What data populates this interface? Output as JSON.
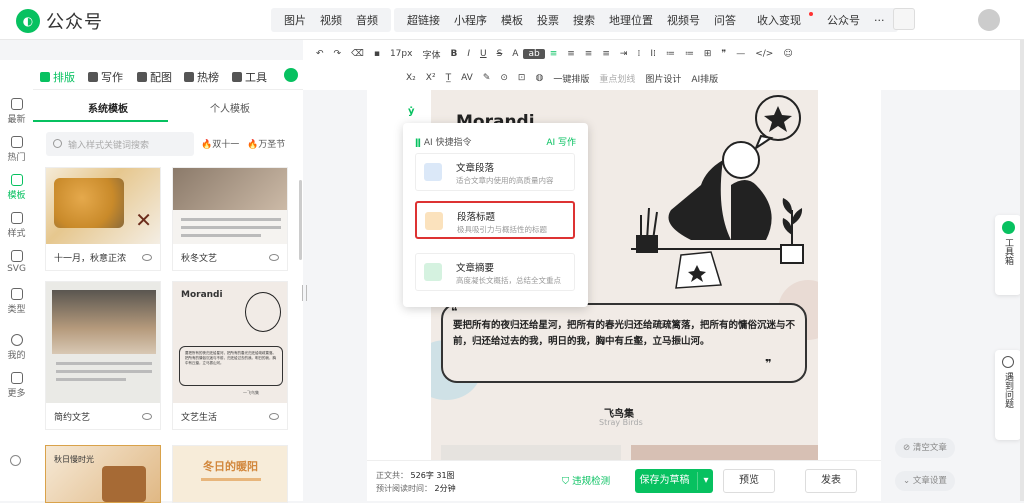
{
  "app": {
    "title": "公众号"
  },
  "top_menu": {
    "media": [
      "图片",
      "视频",
      "音频"
    ],
    "insert": [
      "超链接",
      "小程序",
      "模板",
      "投票",
      "搜索",
      "地理位置",
      "视频号",
      "问答",
      "收入变现",
      "公众号",
      "···"
    ]
  },
  "sidebar_tabs": [
    "排版",
    "写作",
    "配图",
    "热榜",
    "工具"
  ],
  "left_rail": [
    "最新",
    "热门",
    "模板",
    "样式",
    "SVG",
    "类型",
    "我的",
    "更多"
  ],
  "panel": {
    "subtabs": [
      "系统模板",
      "个人模板"
    ],
    "search_placeholder": "输入样式关键词搜索",
    "hot_chips": [
      "双十一",
      "万圣节"
    ],
    "templates": [
      {
        "name": "十一月，秋意正浓"
      },
      {
        "name": "秋冬文艺"
      },
      {
        "name": "简约文艺"
      },
      {
        "name": "文艺生活"
      },
      {
        "name": "秋日慢时光"
      },
      {
        "name": "冬日的暖阳"
      }
    ],
    "thumb_text": {
      "morandi": "Morandi",
      "quote": "要把所有的夜归还给星河，把所有的春光归还给疏疏篱落。把所有的慵俗沉迷与不前，归还给过去的我。明日的我，胸中有丘壑，立马振山河。",
      "author": "一飞鸟集"
    }
  },
  "toolbar": {
    "row1": [
      "↶",
      "↷",
      "⌫",
      "▪",
      "17px",
      "字体",
      "B",
      "I",
      "U",
      "S",
      "A",
      "ab",
      "≡",
      "≡",
      "≡",
      "≡",
      "⇥",
      "⁞",
      "I⁞",
      "≔",
      "≔",
      "⊞",
      "❞",
      "—",
      "</>",
      "☺"
    ],
    "row2": [
      "X₂",
      "X²",
      "T̲",
      "AV",
      "✎",
      "⊙",
      "⊡",
      "◍",
      "一键排版",
      "重点划线",
      "图片设计",
      "AI排版"
    ]
  },
  "article": {
    "title": "Morandi",
    "quote": "要把所有的夜归还给星河，把所有的春光归还给疏疏篱落，把所有的慵俗沉迷与不前，归还给过去的我，明日的我，胸中有丘壑，立马振山河。",
    "book_cn": "飞鸟集",
    "book_en": "Stray Birds",
    "open_quote": "❝",
    "close_quote": "❞"
  },
  "ai_popup": {
    "header": "AI 快捷指令",
    "write": "AI 写作",
    "items": [
      {
        "title": "文章段落",
        "desc": "适合文章内使用的高质量内容"
      },
      {
        "title": "段落标题",
        "desc": "极具吸引力与概括性的标题"
      },
      {
        "title": "文章摘要",
        "desc": "高度凝长文概括，总结全文重点"
      }
    ]
  },
  "bottom": {
    "word_label": "正文共：",
    "word_value": "526字 31图",
    "time_label": "预计阅读时间：",
    "time_value": "2分钟",
    "check": "违规检测",
    "save": "保存为草稿",
    "preview": "预览",
    "publish": "发表"
  },
  "right_float": {
    "toolbox": "工具箱",
    "help": "遇到问题"
  },
  "right_actions": {
    "clear": "清空文章",
    "settings": "文章设置"
  },
  "colors": {
    "brand": "#07c160",
    "highlight": "#d33333",
    "article_bg": "#f1ebe6"
  }
}
